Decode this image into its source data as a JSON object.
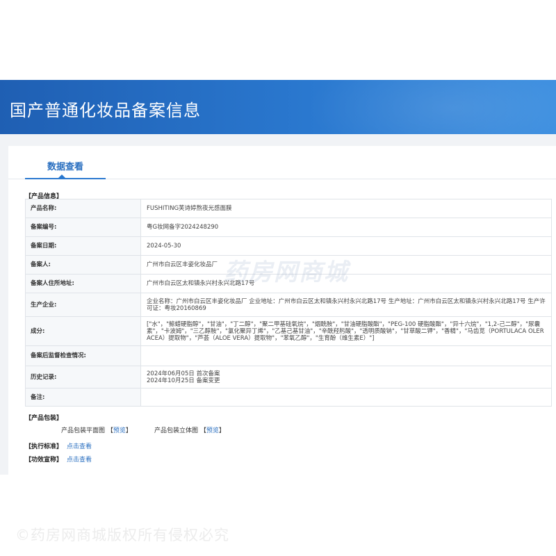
{
  "header": {
    "title": "国产普通化妆品备案信息"
  },
  "tabs": [
    {
      "label": "数据查看",
      "active": true
    }
  ],
  "product_info": {
    "section_label": "【产品信息】",
    "rows": [
      {
        "key": "产品名称:",
        "value": "FUSHITING芙诗婷熬夜光感面膜"
      },
      {
        "key": "备案编号:",
        "value": "粤G妆网备字2024248290"
      },
      {
        "key": "备案日期:",
        "value": "2024-05-30"
      },
      {
        "key": "备案人:",
        "value": "广州市白云区丰姿化妆品厂"
      },
      {
        "key": "备案人住所地址:",
        "value": "广州市白云区太和镇永兴村永兴北路17号"
      },
      {
        "key": "生产企业:",
        "value": "企业名称：广州市白云区丰姿化妆品厂 企业地址：广州市白云区太和镇永兴村永兴北路17号 生产地址：广州市白云区太和镇永兴村永兴北路17号 生产许可证：粤妆20160869"
      },
      {
        "key": "成分:",
        "value": "[\"水\"，\"鲸蜡硬脂醇\"，\"甘油\"，\"丁二醇\"，\"聚二甲基硅氧烷\"，\"烟酰胺\"，\"甘油硬脂酸酯\"，\"PEG-100 硬脂酸酯\"，\"异十六烷\"，\"1,2-己二醇\"，\"尿囊素\"，\"卡波姆\"，\"三乙醇胺\"，\"氯化聚异丁烯\"，\"乙基己基甘油\"，\"辛酰羟肟酸\"，\"透明质酸钠\"，\"甘草酸二钾\"，\"香精\"，\"马齿苋（PORTULACA OLERACEA）提取物\"，\"芦荟（ALOE VERA）提取物\"，\"苯氧乙醇\"，\"生育酚（维生素E）\"]"
      },
      {
        "key": "备案后监督检查情况:",
        "value": ""
      },
      {
        "key": "历史记录:",
        "lines": [
          "2024年06月05日 首次备案",
          "2024年10月25日 备案变更"
        ]
      },
      {
        "key": "备注:",
        "value": ""
      }
    ]
  },
  "watermark": "药房网商城",
  "packaging": {
    "section_label": "【产品包装】",
    "items": [
      {
        "label": "产品包装平面图",
        "bracket_open": "【",
        "link": "预览",
        "bracket_close": "】"
      },
      {
        "label": "产品包装立体图",
        "bracket_open": "【",
        "link": "预览",
        "bracket_close": "】"
      }
    ]
  },
  "execution_standard": {
    "label": "【执行标准】",
    "link": "点击查看"
  },
  "efficacy_claim": {
    "label": "【功效宣称】",
    "link": "点击查看"
  },
  "footer_watermark": "©药房网商城版权所有侵权必究"
}
